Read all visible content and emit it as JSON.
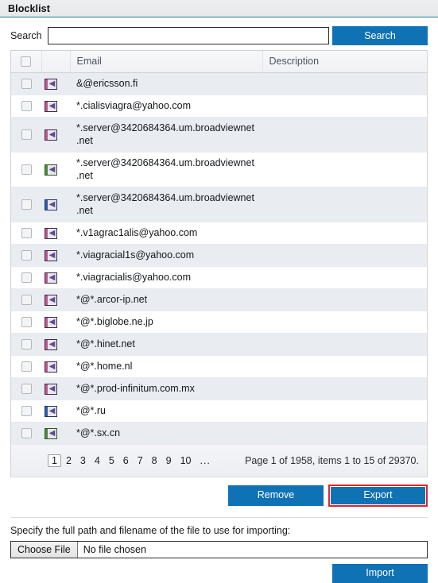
{
  "window": {
    "title": "Blocklist"
  },
  "search": {
    "label": "Search",
    "value": "",
    "placeholder": "",
    "button_label": "Search"
  },
  "table": {
    "columns": {
      "select_all": "",
      "icon": "",
      "email": "Email",
      "description": "Description"
    },
    "rows": [
      {
        "icon": "blocklist-arrow-icon",
        "icon_variant": "v-pink",
        "email": "&@ericsson.fi",
        "description": ""
      },
      {
        "icon": "blocklist-arrow-icon",
        "icon_variant": "v-pink",
        "email": "*.cialisviagra@yahoo.com",
        "description": ""
      },
      {
        "icon": "blocklist-arrow-icon",
        "icon_variant": "v-pink",
        "email": "*.server@3420684364.um.broadviewnet.net",
        "description": ""
      },
      {
        "icon": "blocklist-arrow-icon",
        "icon_variant": "v-green",
        "email": "*.server@3420684364.um.broadviewnet.net",
        "description": ""
      },
      {
        "icon": "blocklist-arrow-icon",
        "icon_variant": "v-blue",
        "email": "*.server@3420684364.um.broadviewnet.net",
        "description": ""
      },
      {
        "icon": "blocklist-arrow-icon",
        "icon_variant": "v-pink",
        "email": "*.v1agrac1alis@yahoo.com",
        "description": ""
      },
      {
        "icon": "blocklist-arrow-icon",
        "icon_variant": "v-pink",
        "email": "*.viagracial1s@yahoo.com",
        "description": ""
      },
      {
        "icon": "blocklist-arrow-icon",
        "icon_variant": "v-pink",
        "email": "*.viagracialis@yahoo.com",
        "description": ""
      },
      {
        "icon": "blocklist-arrow-icon",
        "icon_variant": "v-pink",
        "email": "*@*.arcor-ip.net",
        "description": ""
      },
      {
        "icon": "blocklist-arrow-icon",
        "icon_variant": "v-pink",
        "email": "*@*.biglobe.ne.jp",
        "description": ""
      },
      {
        "icon": "blocklist-arrow-icon",
        "icon_variant": "v-pink",
        "email": "*@*.hinet.net",
        "description": ""
      },
      {
        "icon": "blocklist-arrow-icon",
        "icon_variant": "v-pink",
        "email": "*@*.home.nl",
        "description": ""
      },
      {
        "icon": "blocklist-arrow-icon",
        "icon_variant": "v-pink",
        "email": "*@*.prod-infinitum.com.mx",
        "description": ""
      },
      {
        "icon": "blocklist-arrow-icon",
        "icon_variant": "v-blue",
        "email": "*@*.ru",
        "description": ""
      },
      {
        "icon": "blocklist-arrow-icon",
        "icon_variant": "v-green",
        "email": "*@*.sx.cn",
        "description": ""
      }
    ]
  },
  "pager": {
    "pages": [
      "1",
      "2",
      "3",
      "4",
      "5",
      "6",
      "7",
      "8",
      "9",
      "10",
      "..."
    ],
    "current_page": "1",
    "info": "Page 1 of 1958, items 1 to 15 of 29370."
  },
  "actions": {
    "remove_label": "Remove",
    "export_label": "Export"
  },
  "import": {
    "instruction": "Specify the full path and filename of the file to use for importing:",
    "choose_file_label": "Choose File",
    "file_name": "No file chosen",
    "import_label": "Import"
  },
  "colors": {
    "accent_blue": "#0f72b5",
    "highlight_red": "#d9272e",
    "row_alt": "#e9ecf1",
    "title_border": "#1b7fa8"
  }
}
